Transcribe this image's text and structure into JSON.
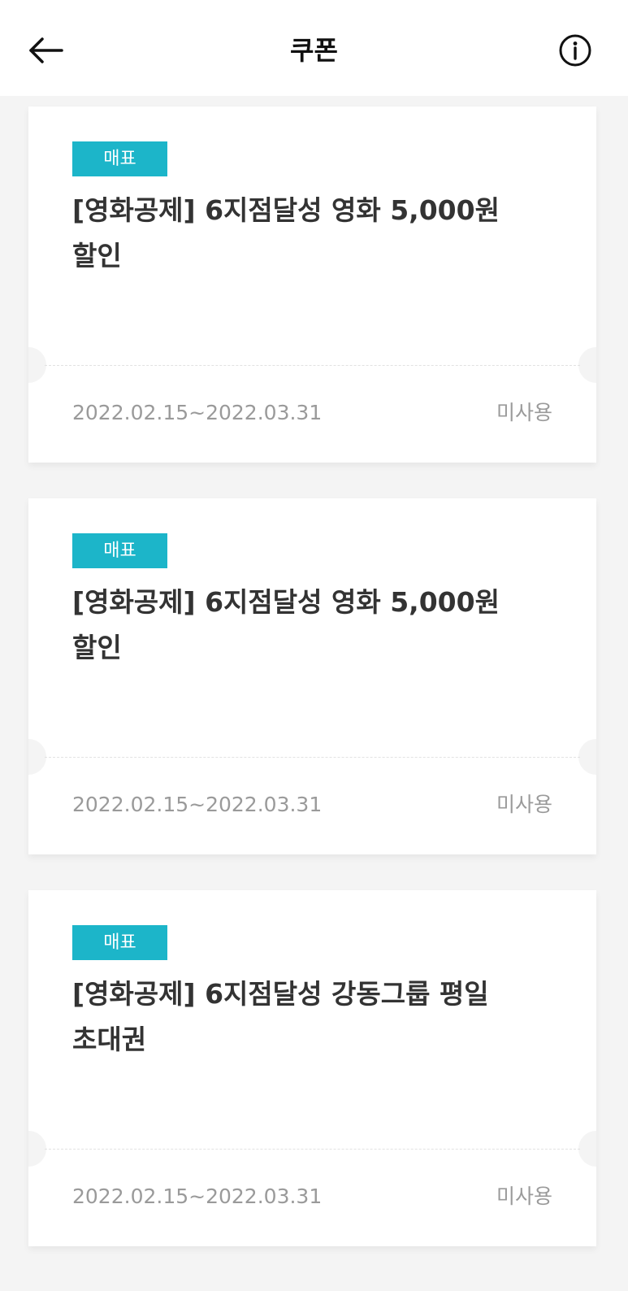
{
  "header": {
    "title": "쿠폰",
    "back_icon": "arrow-left-icon",
    "info_icon": "info-circle-icon"
  },
  "coupons": [
    {
      "badge": "매표",
      "title_line1": "[영화공제] 6지점달성 영화 5,000원",
      "title_line2": "할인",
      "period": "2022.02.15~2022.03.31",
      "status": "미사용"
    },
    {
      "badge": "매표",
      "title_line1": "[영화공제] 6지점달성 영화 5,000원",
      "title_line2": "할인",
      "period": "2022.02.15~2022.03.31",
      "status": "미사용"
    },
    {
      "badge": "매표",
      "title_line1": "[영화공제] 6지점달성 강동그룹 평일",
      "title_line2": "초대권",
      "period": "2022.02.15~2022.03.31",
      "status": "미사용"
    }
  ],
  "colors": {
    "badge_bg": "#1cb5c9",
    "page_bg": "#f4f4f4",
    "title_text": "#333333",
    "muted_text": "#9a9a9a"
  }
}
